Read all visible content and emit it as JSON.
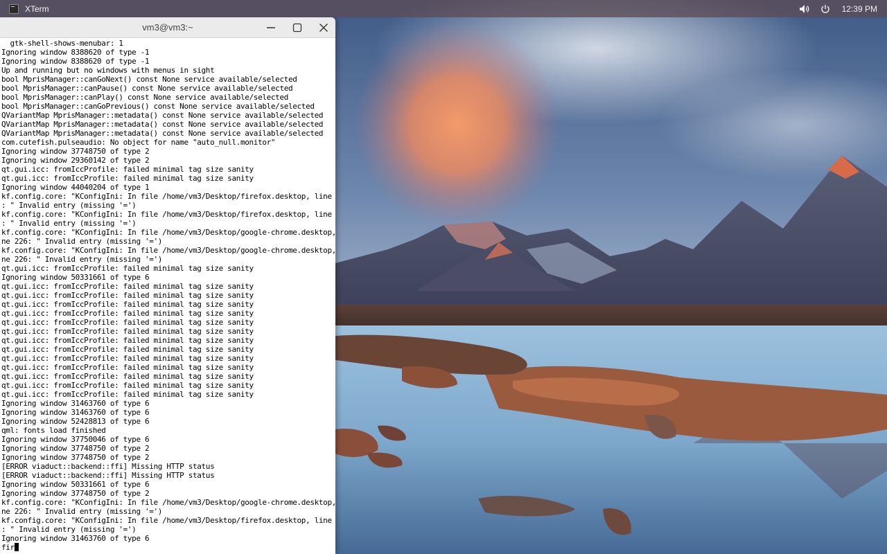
{
  "topbar": {
    "app_name": "XTerm",
    "clock": "12:39 PM",
    "icons": [
      "terminal-app-icon",
      "volume-icon",
      "power-icon"
    ]
  },
  "window": {
    "title": "vm3@vm3:~",
    "buttons": [
      "minimize",
      "maximize",
      "close"
    ]
  },
  "terminal": {
    "lines": [
      "  gtk-shell-shows-menubar: 1",
      "Ignoring window 8388620 of type -1",
      "Ignoring window 8388620 of type -1",
      "Up and running but no windows with menus in sight",
      "bool MprisManager::canGoNext() const None service available/selected",
      "bool MprisManager::canPause() const None service available/selected",
      "bool MprisManager::canPlay() const None service available/selected",
      "bool MprisManager::canGoPrevious() const None service available/selected",
      "QVariantMap MprisManager::metadata() const None service available/selected",
      "QVariantMap MprisManager::metadata() const None service available/selected",
      "QVariantMap MprisManager::metadata() const None service available/selected",
      "com.cutefish.pulseaudio: No object for name \"auto_null.monitor\"",
      "Ignoring window 37748750 of type 2",
      "Ignoring window 29360142 of type 2",
      "qt.gui.icc: fromIccProfile: failed minimal tag size sanity",
      "qt.gui.icc: fromIccProfile: failed minimal tag size sanity",
      "Ignoring window 44040204 of type 1",
      "kf.config.core: \"KConfigIni: In file /home/vm3/Desktop/firefox.desktop, line 342",
      ": \" Invalid entry (missing '=')",
      "kf.config.core: \"KConfigIni: In file /home/vm3/Desktop/firefox.desktop, line 342",
      ": \" Invalid entry (missing '=')",
      "kf.config.core: \"KConfigIni: In file /home/vm3/Desktop/google-chrome.desktop, li",
      "ne 226: \" Invalid entry (missing '=')",
      "kf.config.core: \"KConfigIni: In file /home/vm3/Desktop/google-chrome.desktop, li",
      "ne 226: \" Invalid entry (missing '=')",
      "qt.gui.icc: fromIccProfile: failed minimal tag size sanity",
      "Ignoring window 50331661 of type 6",
      "qt.gui.icc: fromIccProfile: failed minimal tag size sanity",
      "qt.gui.icc: fromIccProfile: failed minimal tag size sanity",
      "qt.gui.icc: fromIccProfile: failed minimal tag size sanity",
      "qt.gui.icc: fromIccProfile: failed minimal tag size sanity",
      "qt.gui.icc: fromIccProfile: failed minimal tag size sanity",
      "qt.gui.icc: fromIccProfile: failed minimal tag size sanity",
      "qt.gui.icc: fromIccProfile: failed minimal tag size sanity",
      "qt.gui.icc: fromIccProfile: failed minimal tag size sanity",
      "qt.gui.icc: fromIccProfile: failed minimal tag size sanity",
      "qt.gui.icc: fromIccProfile: failed minimal tag size sanity",
      "qt.gui.icc: fromIccProfile: failed minimal tag size sanity",
      "qt.gui.icc: fromIccProfile: failed minimal tag size sanity",
      "qt.gui.icc: fromIccProfile: failed minimal tag size sanity",
      "Ignoring window 31463760 of type 6",
      "Ignoring window 31463760 of type 6",
      "Ignoring window 52428813 of type 6",
      "qml: fonts load finished",
      "Ignoring window 37750046 of type 6",
      "Ignoring window 37748750 of type 2",
      "Ignoring window 37748750 of type 2",
      "[ERROR viaduct::backend::ffi] Missing HTTP status",
      "[ERROR viaduct::backend::ffi] Missing HTTP status",
      "Ignoring window 50331661 of type 6",
      "Ignoring window 37748750 of type 2",
      "kf.config.core: \"KConfigIni: In file /home/vm3/Desktop/google-chrome.desktop, li",
      "ne 226: \" Invalid entry (missing '=')",
      "kf.config.core: \"KConfigIni: In file /home/vm3/Desktop/firefox.desktop, line 342",
      ": \" Invalid entry (missing '=')",
      "Ignoring window 31463760 of type 6"
    ],
    "prompt_input": "fir"
  },
  "colors": {
    "terminal_bg": "#ffffff",
    "terminal_fg": "#000000",
    "titlebar_bg": "#ebebeb",
    "topbar_bg": "#5c4c56"
  }
}
